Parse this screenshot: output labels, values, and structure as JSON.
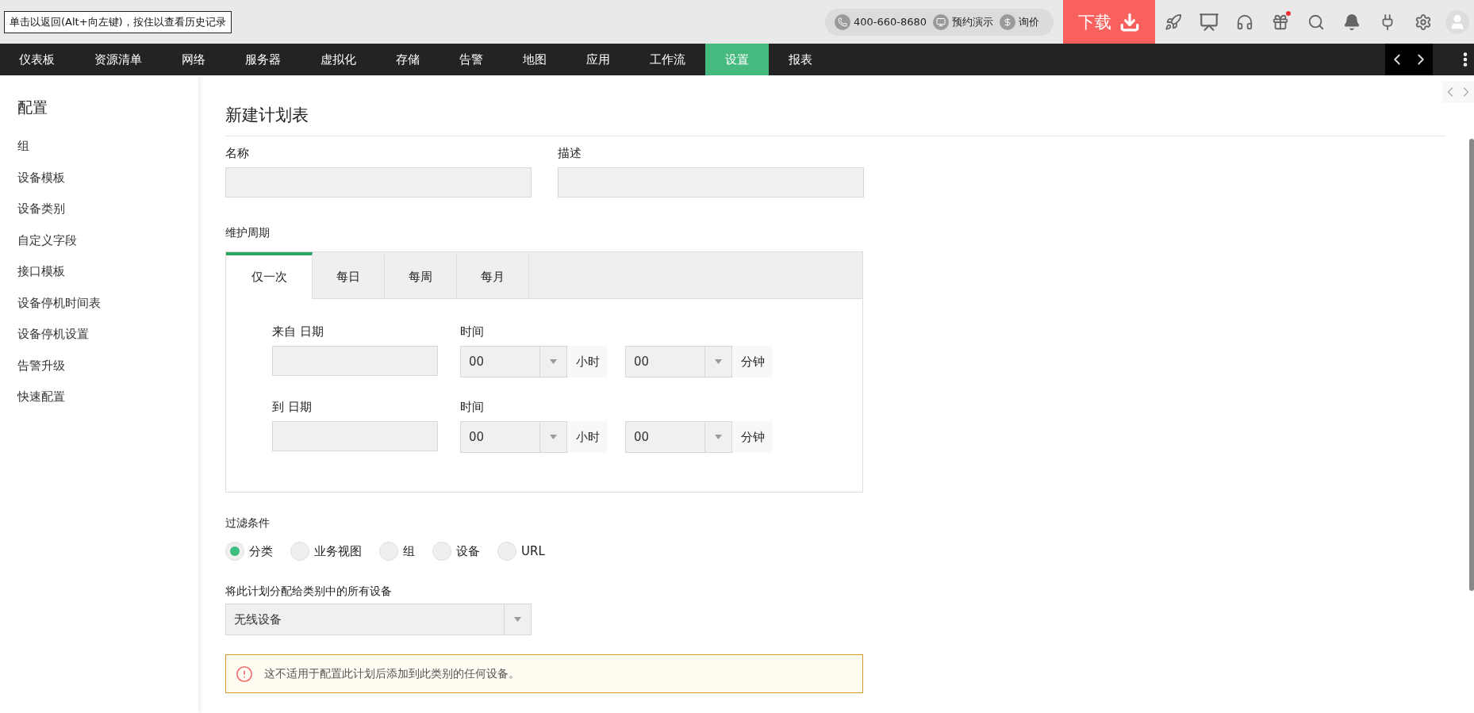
{
  "tooltip": "单击以返回(Alt+向左键)，按住以查看历史记录",
  "header": {
    "phone": "400-660-8680",
    "demo": "预约演示",
    "price": "询价",
    "download": "下载"
  },
  "nav": [
    {
      "label": "仪表板",
      "selected": false
    },
    {
      "label": "资源清单",
      "selected": false
    },
    {
      "label": "网络",
      "selected": false
    },
    {
      "label": "服务器",
      "selected": false
    },
    {
      "label": "虚拟化",
      "selected": false
    },
    {
      "label": "存储",
      "selected": false
    },
    {
      "label": "告警",
      "selected": false
    },
    {
      "label": "地图",
      "selected": false
    },
    {
      "label": "应用",
      "selected": false
    },
    {
      "label": "工作流",
      "selected": false
    },
    {
      "label": "设置",
      "selected": true
    },
    {
      "label": "报表",
      "selected": false
    }
  ],
  "sidebar": {
    "title": "配置",
    "items": [
      "组",
      "设备模板",
      "设备类别",
      "自定义字段",
      "接口模板",
      "设备停机时间表",
      "设备停机设置",
      "告警升级",
      "快速配置"
    ]
  },
  "form": {
    "title": "新建计划表",
    "name_label": "名称",
    "description_label": "描述",
    "period_label": "维护周期",
    "period_tabs": [
      {
        "label": "仅一次",
        "selected": true
      },
      {
        "label": "每日",
        "selected": false
      },
      {
        "label": "每周",
        "selected": false
      },
      {
        "label": "每月",
        "selected": false
      }
    ],
    "rows": [
      {
        "date_label": "来自 日期",
        "time_label": "时间",
        "hour": "00",
        "hour_unit": "小时",
        "minute": "00",
        "minute_unit": "分钟"
      },
      {
        "date_label": "到 日期",
        "time_label": "时间",
        "hour": "00",
        "hour_unit": "小时",
        "minute": "00",
        "minute_unit": "分钟"
      }
    ],
    "filter_label": "过滤条件",
    "filter_options": [
      {
        "label": "分类",
        "selected": true
      },
      {
        "label": "业务视图",
        "selected": false
      },
      {
        "label": "组",
        "selected": false
      },
      {
        "label": "设备",
        "selected": false
      },
      {
        "label": "URL",
        "selected": false
      }
    ],
    "assign_label": "将此计划分配给类别中的所有设备",
    "category": "无线设备",
    "warning": "这不适用于配置此计划后添加到此类别的任何设备。"
  }
}
